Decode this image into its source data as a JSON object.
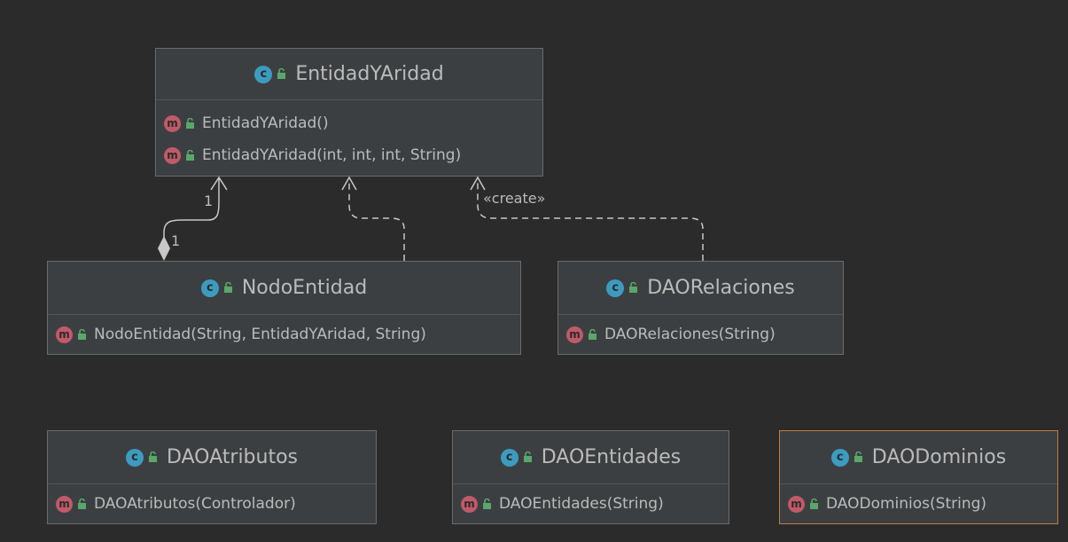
{
  "colors": {
    "background": "#2b2b2b",
    "box_fill": "#3c3f41",
    "box_border": "#6b6b6b",
    "selected_border": "#c47d3b",
    "class_badge": "#3d9bc0",
    "method_badge": "#c15a68",
    "lock_icon": "#59a869",
    "edge": "#c8c8c8"
  },
  "icons": {
    "class_badge_letter": "c",
    "method_badge_letter": "m",
    "class_icon": "class-icon",
    "method_icon": "method-icon",
    "visibility_icon": "public-lock-icon"
  },
  "classes": {
    "entidad": {
      "name": "EntidadYAridad",
      "methods": [
        "EntidadYAridad()",
        "EntidadYAridad(int, int, int, String)"
      ]
    },
    "nodo": {
      "name": "NodoEntidad",
      "methods": [
        "NodoEntidad(String, EntidadYAridad, String)"
      ]
    },
    "relaciones": {
      "name": "DAORelaciones",
      "methods": [
        "DAORelaciones(String)"
      ]
    },
    "atributos": {
      "name": "DAOAtributos",
      "methods": [
        "DAOAtributos(Controlador)"
      ]
    },
    "entidades": {
      "name": "DAOEntidades",
      "methods": [
        "DAOEntidades(String)"
      ]
    },
    "dominios": {
      "name": "DAODominios",
      "methods": [
        "DAODominios(String)"
      ]
    }
  },
  "edges": {
    "composition": {
      "target_multiplicity": "1",
      "source_multiplicity": "1"
    },
    "dependency_create": {
      "stereotype": "«create»"
    }
  }
}
